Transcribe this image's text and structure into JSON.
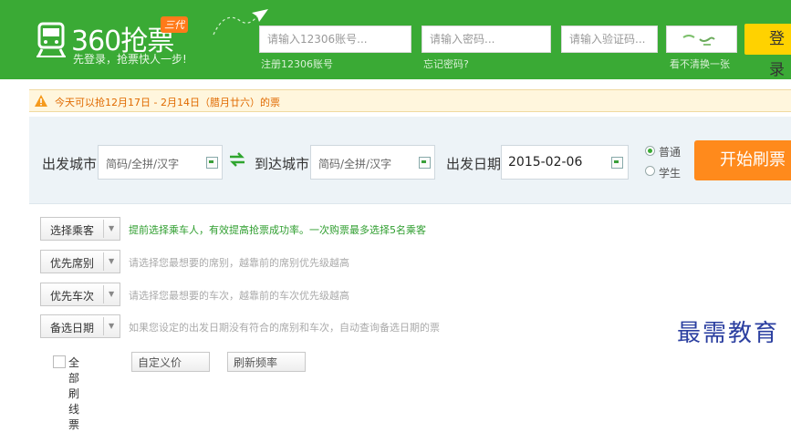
{
  "header": {
    "logo_title": "360抢票",
    "logo_badge": "三代",
    "slogan": "先登录，抢票快人一步!",
    "account_placeholder": "请输入12306账号...",
    "password_placeholder": "请输入密码...",
    "captcha_placeholder": "请输入验证码...",
    "register_link": "注册12306账号",
    "forgot_link": "忘记密码?",
    "captcha_refresh": "看不清换一张",
    "login_label": "登录"
  },
  "notice": {
    "text": "今天可以抢12月17日 - 2月14日（腊月廿六）的票"
  },
  "search": {
    "from_label": "出发城市",
    "from_placeholder": "简码/全拼/汉字",
    "to_label": "到达城市",
    "to_placeholder": "简码/全拼/汉字",
    "date_label": "出发日期",
    "date_value": "2015-02-06",
    "ticket_types": [
      "普通",
      "学生"
    ],
    "start_label": "开始刷票"
  },
  "options": [
    {
      "label": "选择乘客",
      "hint": "提前选择乘车人，有效提高抢票成功率。一次购票最多选择5名乘客"
    },
    {
      "label": "优先席别",
      "hint": "请选择您最想要的席别，越靠前的席别优先级越高"
    },
    {
      "label": "优先车次",
      "hint": "请选择您最想要的车次，越靠前的车次优先级越高"
    },
    {
      "label": "备选日期",
      "hint": "如果您设定的出发日期没有符合的席别和车次，自动查询备选日期的票"
    }
  ],
  "bottom": {
    "checkbox_label": "全部刷线票",
    "select1": "自定义价",
    "select2": "刷新频率"
  },
  "watermark": "最需教育",
  "colors": {
    "header_green": "#3aaa35",
    "login_yellow": "#ffd200",
    "start_orange": "#ff8a1c",
    "notice_text": "#e06a00"
  }
}
